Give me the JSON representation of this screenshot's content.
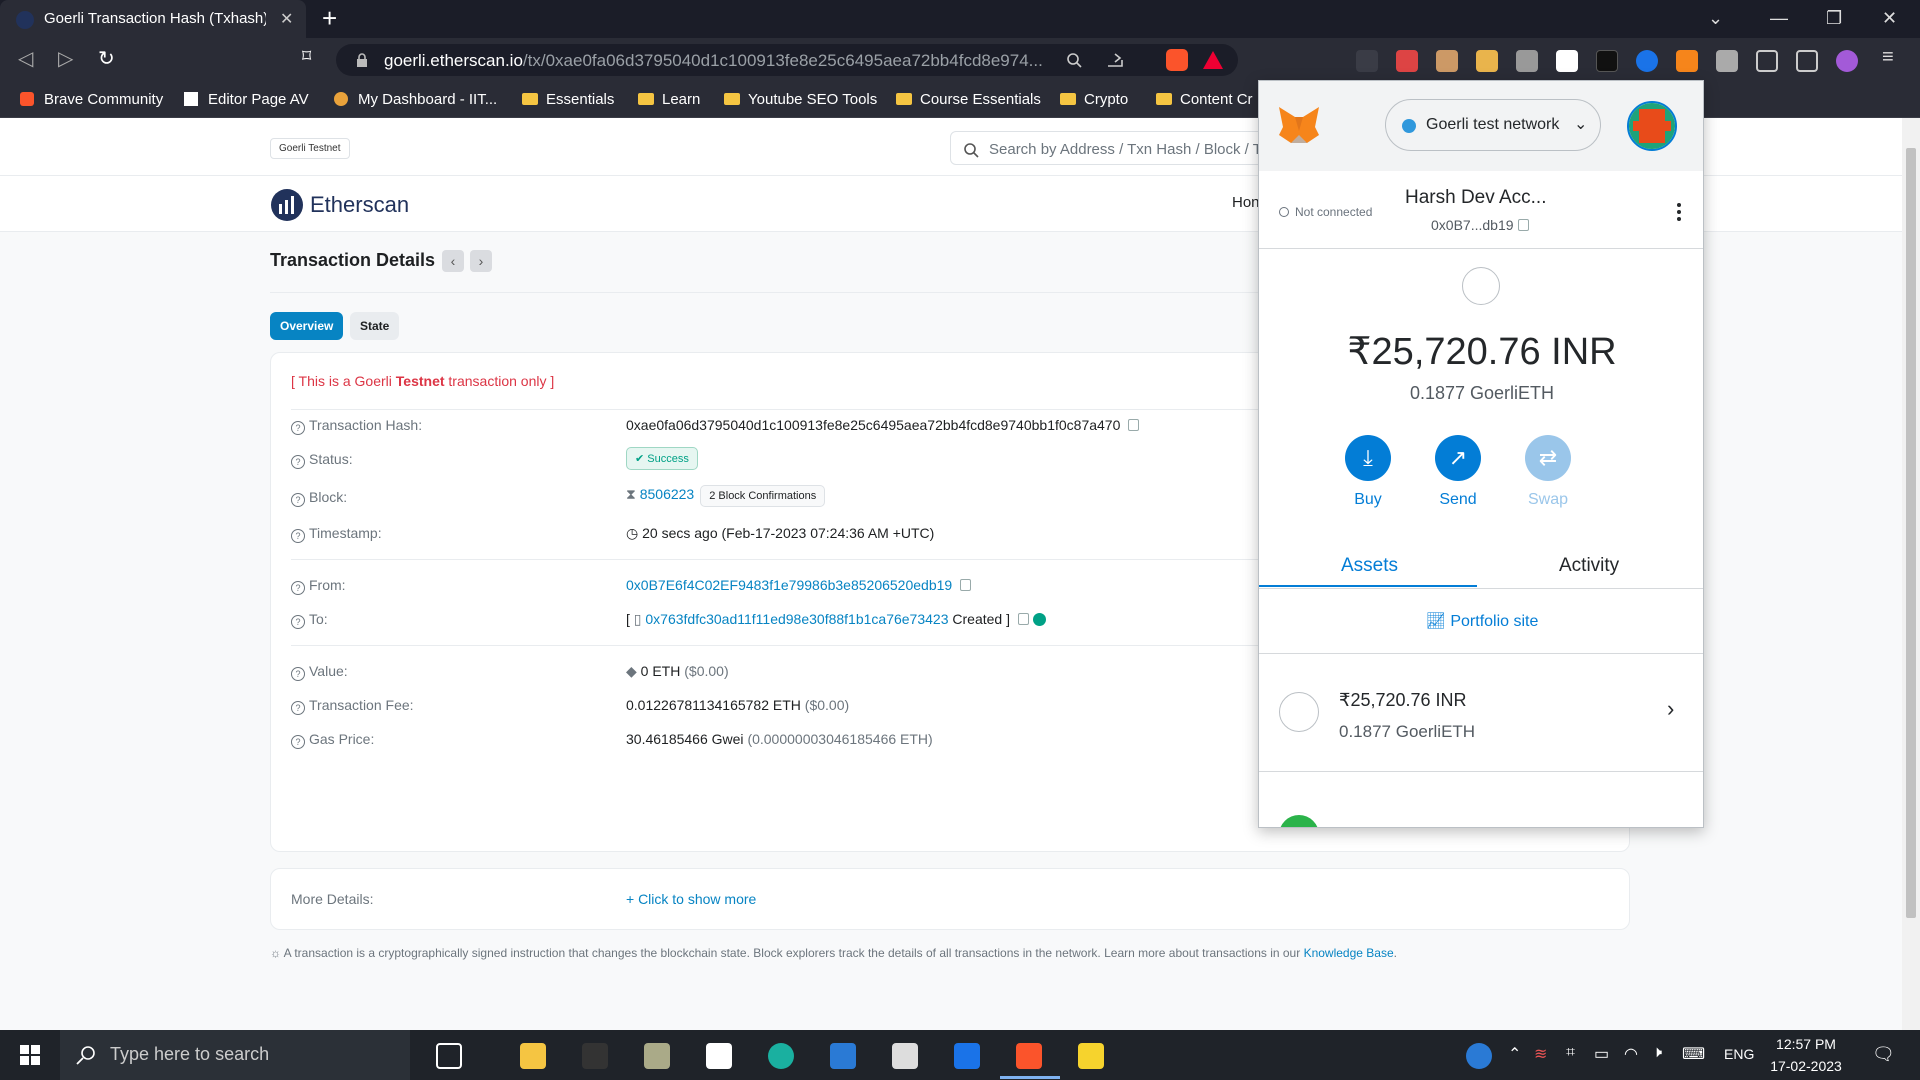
{
  "browser": {
    "tab_title": "Goerli Transaction Hash (Txhash) | E",
    "url_host": "goerli.etherscan.io",
    "url_path": "/tx/0xae0fa06d3795040d1c100913fe8e25c6495aea72bb4fcd8e974...",
    "bookmarks": [
      "Brave Community",
      "Editor Page AV",
      "My Dashboard - IIT...",
      "Essentials",
      "Learn",
      "Youtube SEO Tools",
      "Course Essentials",
      "Crypto",
      "Content Cr"
    ]
  },
  "site": {
    "network_badge": "Goerli Testnet",
    "search_placeholder": "Search by Address / Txn Hash / Block / T",
    "logo_text": "Etherscan",
    "nav_home": "Hon"
  },
  "tx": {
    "page_title": "Transaction Details",
    "tabs": [
      "Overview",
      "State"
    ],
    "testnet_notice_pre": "[ This is a Goerli ",
    "testnet_notice_bold": "Testnet",
    "testnet_notice_post": " transaction only ]",
    "labels": {
      "hash": "Transaction Hash:",
      "status": "Status:",
      "block": "Block:",
      "timestamp": "Timestamp:",
      "from": "From:",
      "to": "To:",
      "value": "Value:",
      "fee": "Transaction Fee:",
      "gas": "Gas Price:",
      "more": "More Details:"
    },
    "hash": "0xae0fa06d3795040d1c100913fe8e25c6495aea72bb4fcd8e9740bb1f0c87a470",
    "status": "Success",
    "block": "8506223",
    "confirmations": "2 Block Confirmations",
    "timestamp": "20 secs ago (Feb-17-2023 07:24:36 AM +UTC)",
    "from": "0x0B7E6f4C02EF9483f1e79986b3e85206520edb19",
    "to_prefix": "[",
    "to": "0x763fdfc30ad11f11ed98e30f88f1b1ca76e73423",
    "to_suffix": "Created ]",
    "value": "0 ETH",
    "value_usd": "($0.00)",
    "fee": "0.01226781134165782 ETH",
    "fee_usd": "($0.00)",
    "gas": "30.46185466 Gwei",
    "gas_eth": "(0.00000003046185466 ETH)",
    "more_link": "+ Click to show more",
    "footnote": "A transaction is a cryptographically signed instruction that changes the blockchain state. Block explorers track the details of all transactions in the network. Learn more about transactions in our ",
    "footnote_link": "Knowledge Base",
    "footnote_end": "."
  },
  "metamask": {
    "network": "Goerli test network",
    "connection": "Not connected",
    "account_name": "Harsh Dev Acc...",
    "account_addr": "0x0B7...db19",
    "balance_fiat": "₹25,720.76 INR",
    "balance_eth": "0.1877 GoerliETH",
    "actions": [
      "Buy",
      "Send",
      "Swap"
    ],
    "tabs": [
      "Assets",
      "Activity"
    ],
    "portfolio": "Portfolio site",
    "asset_fiat": "₹25,720.76 INR",
    "asset_eth": "0.1877 GoerliETH",
    "colors": {
      "primary": "#037dd6",
      "swap_disabled": "#9ac6ea"
    }
  },
  "taskbar": {
    "search_placeholder": "Type here to search",
    "lang": "ENG",
    "time": "12:57 PM",
    "date": "17-02-2023"
  },
  "colors": {
    "link": "#0784c3",
    "success": "#00a186",
    "testnet_red": "#dc3545",
    "etherscan_blue": "#21325b"
  }
}
